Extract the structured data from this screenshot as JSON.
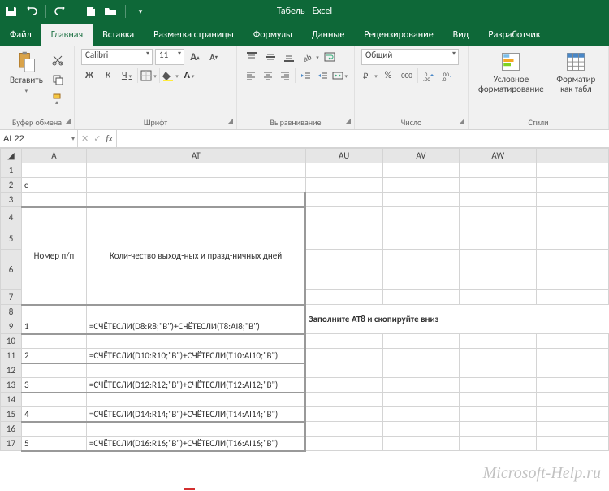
{
  "title": "Табель - Excel",
  "tabs": {
    "file": "Файл",
    "home": "Главная",
    "insert": "Вставка",
    "layout": "Разметка страницы",
    "formulas": "Формулы",
    "data": "Данные",
    "review": "Рецензирование",
    "view": "Вид",
    "dev": "Разработчик"
  },
  "ribbon": {
    "clipboard": {
      "label": "Буфер обмена",
      "paste": "Вставить"
    },
    "font": {
      "label": "Шрифт",
      "name": "Calibri",
      "size": "11",
      "bold": "Ж",
      "italic": "К",
      "underline": "Ч"
    },
    "alignment": {
      "label": "Выравнивание"
    },
    "number": {
      "label": "Число",
      "format": "Общий",
      "percent": "%",
      "comma": "000"
    },
    "styles": {
      "label": "Стили",
      "cond": "Условное форматирование",
      "table": "Форматир как табл"
    }
  },
  "namebox": "AL22",
  "fbar_fx": "fx",
  "columns": {
    "A": "A",
    "AT": "AT",
    "AU": "AU",
    "AV": "AV",
    "AW": "AW"
  },
  "rows": {
    "r4_7_A": "Номер п/п",
    "r4_7_AT": "Коли-чество выход-ных и празд-ничных дней",
    "r2_A": "с",
    "r9_A": "1",
    "r9_AT": "=СЧЁТЕСЛИ(D8:R8;\"В\")+СЧЁТЕСЛИ(T8:AI8;\"В\")",
    "r11_A": "2",
    "r11_AT": "=СЧЁТЕСЛИ(D10:R10;\"В\")+СЧЁТЕСЛИ(T10:AI10;\"В\")",
    "r13_A": "3",
    "r13_AT": "=СЧЁТЕСЛИ(D12:R12;\"В\")+СЧЁТЕСЛИ(T12:AI12;\"В\")",
    "r15_A": "4",
    "r15_AT": "=СЧЁТЕСЛИ(D14:R14;\"В\")+СЧЁТЕСЛИ(T14:AI14;\"В\")",
    "r17_A": "5",
    "r17_AT": "=СЧЁТЕСЛИ(D16:R16;\"В\")+СЧЁТЕСЛИ(T16:AI16;\"В\")"
  },
  "annotation": "Заполните АТ8 и скопируйте вниз",
  "watermark": "Microsoft-Help.ru"
}
